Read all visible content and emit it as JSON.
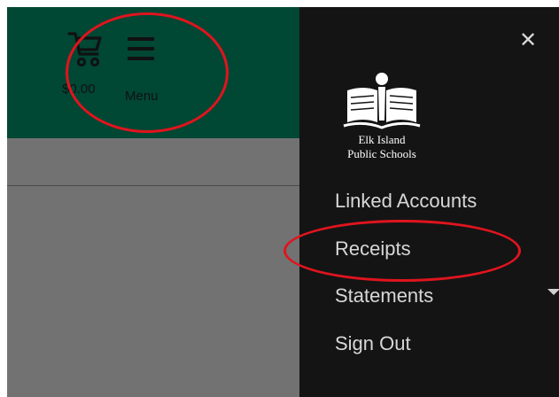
{
  "colors": {
    "header_green": "#004734",
    "backdrop_gray": "#727272",
    "drawer_black": "#141414",
    "annotation_red": "#e0141e"
  },
  "header": {
    "cart_icon": "shopping-cart-icon",
    "cart_total": "$0.00",
    "menu_icon": "hamburger-menu-icon",
    "menu_label": "Menu"
  },
  "drawer": {
    "close_glyph": "✕",
    "logo": {
      "line1": "Elk Island",
      "line2": "Public Schools"
    },
    "nav_items": [
      {
        "label": "Linked Accounts"
      },
      {
        "label": "Receipts"
      },
      {
        "label": "Statements",
        "has_dropdown": true
      },
      {
        "label": "Sign Out"
      }
    ]
  }
}
